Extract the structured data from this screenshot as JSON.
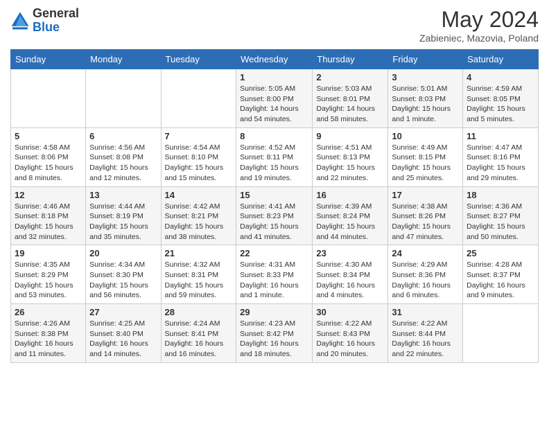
{
  "header": {
    "logo_general": "General",
    "logo_blue": "Blue",
    "month_title": "May 2024",
    "subtitle": "Zabieniec, Mazovia, Poland"
  },
  "weekdays": [
    "Sunday",
    "Monday",
    "Tuesday",
    "Wednesday",
    "Thursday",
    "Friday",
    "Saturday"
  ],
  "weeks": [
    [
      {
        "day": "",
        "info": ""
      },
      {
        "day": "",
        "info": ""
      },
      {
        "day": "",
        "info": ""
      },
      {
        "day": "1",
        "info": "Sunrise: 5:05 AM\nSunset: 8:00 PM\nDaylight: 14 hours\nand 54 minutes."
      },
      {
        "day": "2",
        "info": "Sunrise: 5:03 AM\nSunset: 8:01 PM\nDaylight: 14 hours\nand 58 minutes."
      },
      {
        "day": "3",
        "info": "Sunrise: 5:01 AM\nSunset: 8:03 PM\nDaylight: 15 hours\nand 1 minute."
      },
      {
        "day": "4",
        "info": "Sunrise: 4:59 AM\nSunset: 8:05 PM\nDaylight: 15 hours\nand 5 minutes."
      }
    ],
    [
      {
        "day": "5",
        "info": "Sunrise: 4:58 AM\nSunset: 8:06 PM\nDaylight: 15 hours\nand 8 minutes."
      },
      {
        "day": "6",
        "info": "Sunrise: 4:56 AM\nSunset: 8:08 PM\nDaylight: 15 hours\nand 12 minutes."
      },
      {
        "day": "7",
        "info": "Sunrise: 4:54 AM\nSunset: 8:10 PM\nDaylight: 15 hours\nand 15 minutes."
      },
      {
        "day": "8",
        "info": "Sunrise: 4:52 AM\nSunset: 8:11 PM\nDaylight: 15 hours\nand 19 minutes."
      },
      {
        "day": "9",
        "info": "Sunrise: 4:51 AM\nSunset: 8:13 PM\nDaylight: 15 hours\nand 22 minutes."
      },
      {
        "day": "10",
        "info": "Sunrise: 4:49 AM\nSunset: 8:15 PM\nDaylight: 15 hours\nand 25 minutes."
      },
      {
        "day": "11",
        "info": "Sunrise: 4:47 AM\nSunset: 8:16 PM\nDaylight: 15 hours\nand 29 minutes."
      }
    ],
    [
      {
        "day": "12",
        "info": "Sunrise: 4:46 AM\nSunset: 8:18 PM\nDaylight: 15 hours\nand 32 minutes."
      },
      {
        "day": "13",
        "info": "Sunrise: 4:44 AM\nSunset: 8:19 PM\nDaylight: 15 hours\nand 35 minutes."
      },
      {
        "day": "14",
        "info": "Sunrise: 4:42 AM\nSunset: 8:21 PM\nDaylight: 15 hours\nand 38 minutes."
      },
      {
        "day": "15",
        "info": "Sunrise: 4:41 AM\nSunset: 8:23 PM\nDaylight: 15 hours\nand 41 minutes."
      },
      {
        "day": "16",
        "info": "Sunrise: 4:39 AM\nSunset: 8:24 PM\nDaylight: 15 hours\nand 44 minutes."
      },
      {
        "day": "17",
        "info": "Sunrise: 4:38 AM\nSunset: 8:26 PM\nDaylight: 15 hours\nand 47 minutes."
      },
      {
        "day": "18",
        "info": "Sunrise: 4:36 AM\nSunset: 8:27 PM\nDaylight: 15 hours\nand 50 minutes."
      }
    ],
    [
      {
        "day": "19",
        "info": "Sunrise: 4:35 AM\nSunset: 8:29 PM\nDaylight: 15 hours\nand 53 minutes."
      },
      {
        "day": "20",
        "info": "Sunrise: 4:34 AM\nSunset: 8:30 PM\nDaylight: 15 hours\nand 56 minutes."
      },
      {
        "day": "21",
        "info": "Sunrise: 4:32 AM\nSunset: 8:31 PM\nDaylight: 15 hours\nand 59 minutes."
      },
      {
        "day": "22",
        "info": "Sunrise: 4:31 AM\nSunset: 8:33 PM\nDaylight: 16 hours\nand 1 minute."
      },
      {
        "day": "23",
        "info": "Sunrise: 4:30 AM\nSunset: 8:34 PM\nDaylight: 16 hours\nand 4 minutes."
      },
      {
        "day": "24",
        "info": "Sunrise: 4:29 AM\nSunset: 8:36 PM\nDaylight: 16 hours\nand 6 minutes."
      },
      {
        "day": "25",
        "info": "Sunrise: 4:28 AM\nSunset: 8:37 PM\nDaylight: 16 hours\nand 9 minutes."
      }
    ],
    [
      {
        "day": "26",
        "info": "Sunrise: 4:26 AM\nSunset: 8:38 PM\nDaylight: 16 hours\nand 11 minutes."
      },
      {
        "day": "27",
        "info": "Sunrise: 4:25 AM\nSunset: 8:40 PM\nDaylight: 16 hours\nand 14 minutes."
      },
      {
        "day": "28",
        "info": "Sunrise: 4:24 AM\nSunset: 8:41 PM\nDaylight: 16 hours\nand 16 minutes."
      },
      {
        "day": "29",
        "info": "Sunrise: 4:23 AM\nSunset: 8:42 PM\nDaylight: 16 hours\nand 18 minutes."
      },
      {
        "day": "30",
        "info": "Sunrise: 4:22 AM\nSunset: 8:43 PM\nDaylight: 16 hours\nand 20 minutes."
      },
      {
        "day": "31",
        "info": "Sunrise: 4:22 AM\nSunset: 8:44 PM\nDaylight: 16 hours\nand 22 minutes."
      },
      {
        "day": "",
        "info": ""
      }
    ]
  ]
}
